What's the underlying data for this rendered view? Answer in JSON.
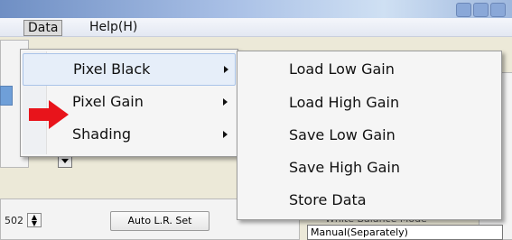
{
  "menubar": {
    "items": [
      {
        "label": "Data",
        "active": true
      },
      {
        "label": "Help(H)",
        "active": false
      }
    ]
  },
  "data_menu": {
    "items": [
      {
        "label": "Pixel Black",
        "has_submenu": true,
        "highlighted": true
      },
      {
        "label": "Pixel Gain",
        "has_submenu": true,
        "highlighted": false
      },
      {
        "label": "Shading",
        "has_submenu": true,
        "highlighted": false
      }
    ]
  },
  "pixel_black_submenu": {
    "items": [
      {
        "label": "Load Low Gain"
      },
      {
        "label": "Load High Gain"
      },
      {
        "label": "Save Low Gain"
      },
      {
        "label": "Save High Gain"
      },
      {
        "label": "Store Data"
      }
    ]
  },
  "background": {
    "spin_value": "502",
    "auto_button_label": "Auto L.R. Set",
    "group_label": "White Balance Mode",
    "combo_value": "Manual(Separately)"
  },
  "annotation": {
    "arrow_color": "#e8141b"
  }
}
